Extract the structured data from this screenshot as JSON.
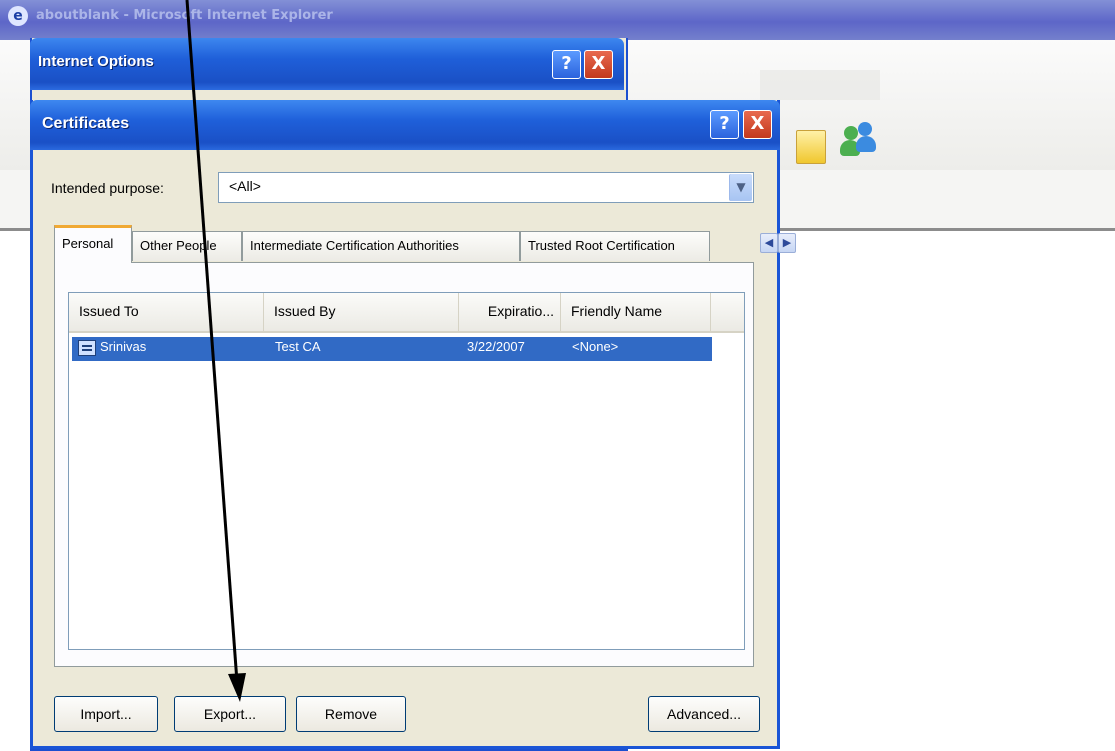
{
  "ie_window": {
    "title": "aboutblank - Microsoft Internet Explorer"
  },
  "internet_options": {
    "title": "Internet Options",
    "help_glyph": "?",
    "close_glyph": "X"
  },
  "certificates": {
    "title": "Certificates",
    "help_glyph": "?",
    "close_glyph": "X",
    "purpose_label": "Intended purpose:",
    "purpose_value": "<All>",
    "tabs": [
      {
        "label": "Personal",
        "active": true
      },
      {
        "label": "Other People",
        "active": false
      },
      {
        "label": "Intermediate Certification Authorities",
        "active": false
      },
      {
        "label": "Trusted Root Certification",
        "active": false
      }
    ],
    "columns": [
      "Issued To",
      "Issued By",
      "Expiratio...",
      "Friendly Name"
    ],
    "rows": [
      {
        "issued_to": "Srinivas",
        "issued_by": "Test CA",
        "expiration": "3/22/2007",
        "friendly_name": "<None>",
        "selected": true
      }
    ],
    "buttons": {
      "import": "Import...",
      "export": "Export...",
      "remove": "Remove",
      "advanced": "Advanced..."
    }
  },
  "colors": {
    "selection": "#316ac5",
    "titlebar": "#1f5fd9",
    "dialog_bg": "#ece9d8",
    "active_tab_accent": "#f0a934"
  }
}
